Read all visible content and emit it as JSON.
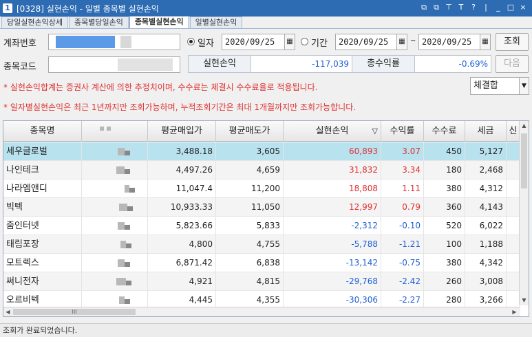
{
  "window": {
    "badge": "1",
    "title": "[0328] 실현손익 - 일별 종목별 실현손익",
    "controls": [
      "⧉",
      "⧉",
      "⊤",
      "T",
      "?",
      "|",
      "_",
      "□",
      "×"
    ]
  },
  "tabs": [
    {
      "label": "당일실현손익상세",
      "active": false
    },
    {
      "label": "종목별당일손익",
      "active": false
    },
    {
      "label": "종목별실현손익",
      "active": true
    },
    {
      "label": "일별실현손익",
      "active": false
    }
  ],
  "form": {
    "account_label": "계좌번호",
    "stock_code_label": "종목코드",
    "radio_date_label": "일자",
    "radio_period_label": "기간",
    "date_value": "2020/09/25",
    "period_from": "2020/09/25",
    "period_sep": "~",
    "period_to": "2020/09/25",
    "search_button": "조회",
    "next_button": "다음",
    "realized_label": "실현손익",
    "realized_value": "-117,039",
    "return_label": "총수익률",
    "return_value": "-0.69%",
    "select_value": "체결합"
  },
  "notes": [
    "* 실현손익합계는 증권사 계산에 의한 추정치이며, 수수료는 체결시 수수료율로 적용됩니다.",
    "* 일자별실현손익은 최근 1년까지만 조회가능하며, 누적조회기간은 최대 1개월까지만 조회가능합니다."
  ],
  "grid": {
    "headers": [
      "종목명",
      "",
      "평균매입가",
      "평균매도가",
      "실현손익",
      "수익률",
      "수수료",
      "세금",
      "신"
    ],
    "sort_indicator": "▽",
    "rows": [
      {
        "name": "세우글로벌",
        "buy": "3,488.18",
        "sell": "3,605",
        "pnl": "60,893",
        "ret": "3.07",
        "fee": "450",
        "tax": "5,127",
        "sign": "pos"
      },
      {
        "name": "나인테크",
        "buy": "4,497.26",
        "sell": "4,659",
        "pnl": "31,832",
        "ret": "3.34",
        "fee": "180",
        "tax": "2,468",
        "sign": "pos"
      },
      {
        "name": "나라엠앤디",
        "buy": "11,047.4",
        "sell": "11,200",
        "pnl": "18,808",
        "ret": "1.11",
        "fee": "380",
        "tax": "4,312",
        "sign": "pos"
      },
      {
        "name": "빅텍",
        "buy": "10,933.33",
        "sell": "11,050",
        "pnl": "12,997",
        "ret": "0.79",
        "fee": "360",
        "tax": "4,143",
        "sign": "pos"
      },
      {
        "name": "줌인터넷",
        "buy": "5,823.66",
        "sell": "5,833",
        "pnl": "-2,312",
        "ret": "-0.10",
        "fee": "520",
        "tax": "6,022",
        "sign": "neg"
      },
      {
        "name": "태림포장",
        "buy": "4,800",
        "sell": "4,755",
        "pnl": "-5,788",
        "ret": "-1.21",
        "fee": "100",
        "tax": "1,188",
        "sign": "neg"
      },
      {
        "name": "모트렉스",
        "buy": "6,871.42",
        "sell": "6,838",
        "pnl": "-13,142",
        "ret": "-0.75",
        "fee": "380",
        "tax": "4,342",
        "sign": "neg"
      },
      {
        "name": "써니전자",
        "buy": "4,921",
        "sell": "4,815",
        "pnl": "-29,768",
        "ret": "-2.42",
        "fee": "260",
        "tax": "3,008",
        "sign": "neg"
      },
      {
        "name": "오르비텍",
        "buy": "4,445",
        "sell": "4,355",
        "pnl": "-30,306",
        "ret": "-2.27",
        "fee": "280",
        "tax": "3,266",
        "sign": "neg"
      }
    ],
    "hscroll_label": "III"
  },
  "status": {
    "text": "조회가 완료되었습니다."
  },
  "colors": {
    "titlebar": "#2d6bb3",
    "positive": "#e03030",
    "negative": "#1f5fd6",
    "selected_row": "#b9e2ef"
  }
}
